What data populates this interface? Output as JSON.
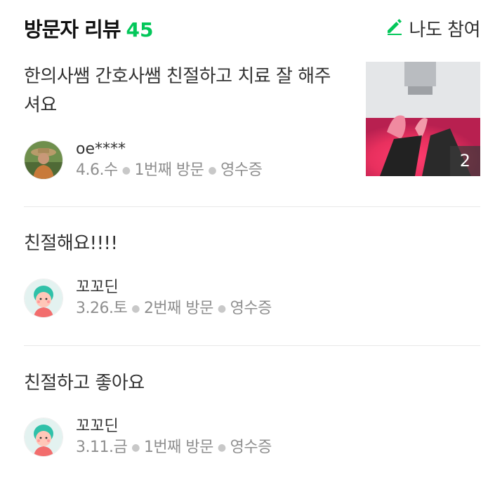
{
  "header": {
    "title": "방문자 리뷰",
    "count": "45",
    "write_label": "나도 참여"
  },
  "reviews": [
    {
      "text": "한의사쌤 간호사쌤 친절하고 치료 잘 해주셔요",
      "nickname": "oe****",
      "date": "4.6.수",
      "visit": "1번째 방문",
      "verify": "영수증",
      "photo_count": "2"
    },
    {
      "text": "친절해요!!!!",
      "nickname": "꼬꼬딘",
      "date": "3.26.토",
      "visit": "2번째 방문",
      "verify": "영수증"
    },
    {
      "text": "친절하고 좋아요",
      "nickname": "꼬꼬딘",
      "date": "3.11.금",
      "visit": "1번째 방문",
      "verify": "영수증"
    }
  ],
  "colors": {
    "accent": "#03c75a",
    "meta_gray": "#8f8f8f",
    "divider": "#e8e8e8"
  }
}
